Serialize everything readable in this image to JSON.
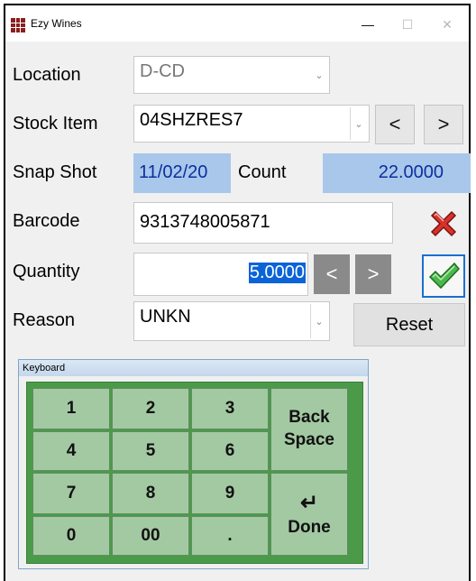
{
  "window": {
    "title": "Ezy Wines",
    "minimize": "—",
    "maximize": "☐",
    "close": "✕"
  },
  "form": {
    "location_label": "Location",
    "location_value": "D-CD",
    "stock_item_label": "Stock Item",
    "stock_item_value": "04SHZRES7",
    "prev_label": "<",
    "next_label": ">",
    "snapshot_label": "Snap Shot",
    "snapshot_value": "11/02/20",
    "count_label": "Count",
    "count_value": "22.0000",
    "barcode_label": "Barcode",
    "barcode_value": "9313748005871",
    "quantity_label": "Quantity",
    "quantity_value": "5.0000",
    "qty_dec_label": "<",
    "qty_inc_label": ">",
    "reason_label": "Reason",
    "reason_value": "UNKN",
    "reset_label": "Reset",
    "dropdown_arrow": "⌄"
  },
  "keyboard": {
    "title": "Keyboard",
    "keys": [
      "1",
      "2",
      "3",
      "4",
      "5",
      "6",
      "7",
      "8",
      "9",
      "0",
      "00",
      "."
    ],
    "back_line1": "Back",
    "back_line2": "Space",
    "enter_glyph": "↵",
    "done_label": "Done"
  },
  "colors": {
    "cancel_icon": "#d9322a",
    "confirm_icon": "#4cb84c",
    "snapshot_bg": "#a9c7ea",
    "keypad_bg": "#4a9a4a"
  }
}
